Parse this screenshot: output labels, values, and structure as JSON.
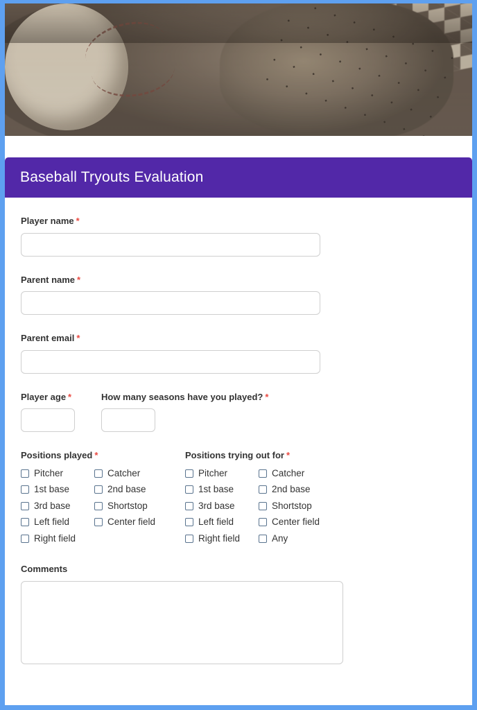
{
  "banner": {
    "alt": "baseball resting in a worn leather catcher glove, sepia toned"
  },
  "header": {
    "title": "Baseball Tryouts Evaluation"
  },
  "form": {
    "required_marker": "*",
    "fields": [
      {
        "label": "Player name",
        "value": "",
        "placeholder": ""
      },
      {
        "label": "Parent name",
        "value": "",
        "placeholder": ""
      },
      {
        "label": "Parent email",
        "value": "",
        "placeholder": ""
      }
    ],
    "age_row": {
      "age": {
        "label": "Player age",
        "value": "",
        "placeholder": ""
      },
      "seasons": {
        "label": "How many seasons have you played?",
        "value": "",
        "placeholder": ""
      }
    },
    "positions_played": {
      "label": "Positions played",
      "options": [
        "Pitcher",
        "Catcher",
        "1st base",
        "2nd base",
        "3rd base",
        "Shortstop",
        "Left field",
        "Center field",
        "Right field"
      ]
    },
    "positions_trying_out_for": {
      "label": "Positions trying out for",
      "options": [
        "Pitcher",
        "Catcher",
        "1st base",
        "2nd base",
        "3rd base",
        "Shortstop",
        "Left field",
        "Center field",
        "Right field",
        "Any"
      ]
    },
    "comments": {
      "label": "Comments",
      "value": "",
      "placeholder": ""
    }
  },
  "colors": {
    "page_border": "#5ea0f0",
    "title_bar": "#5228a8",
    "title_text": "#ffffff",
    "label_text": "#333333",
    "required_asterisk": "#ea4a42",
    "input_border": "#cfcfcf",
    "checkbox_border": "#59738e"
  }
}
